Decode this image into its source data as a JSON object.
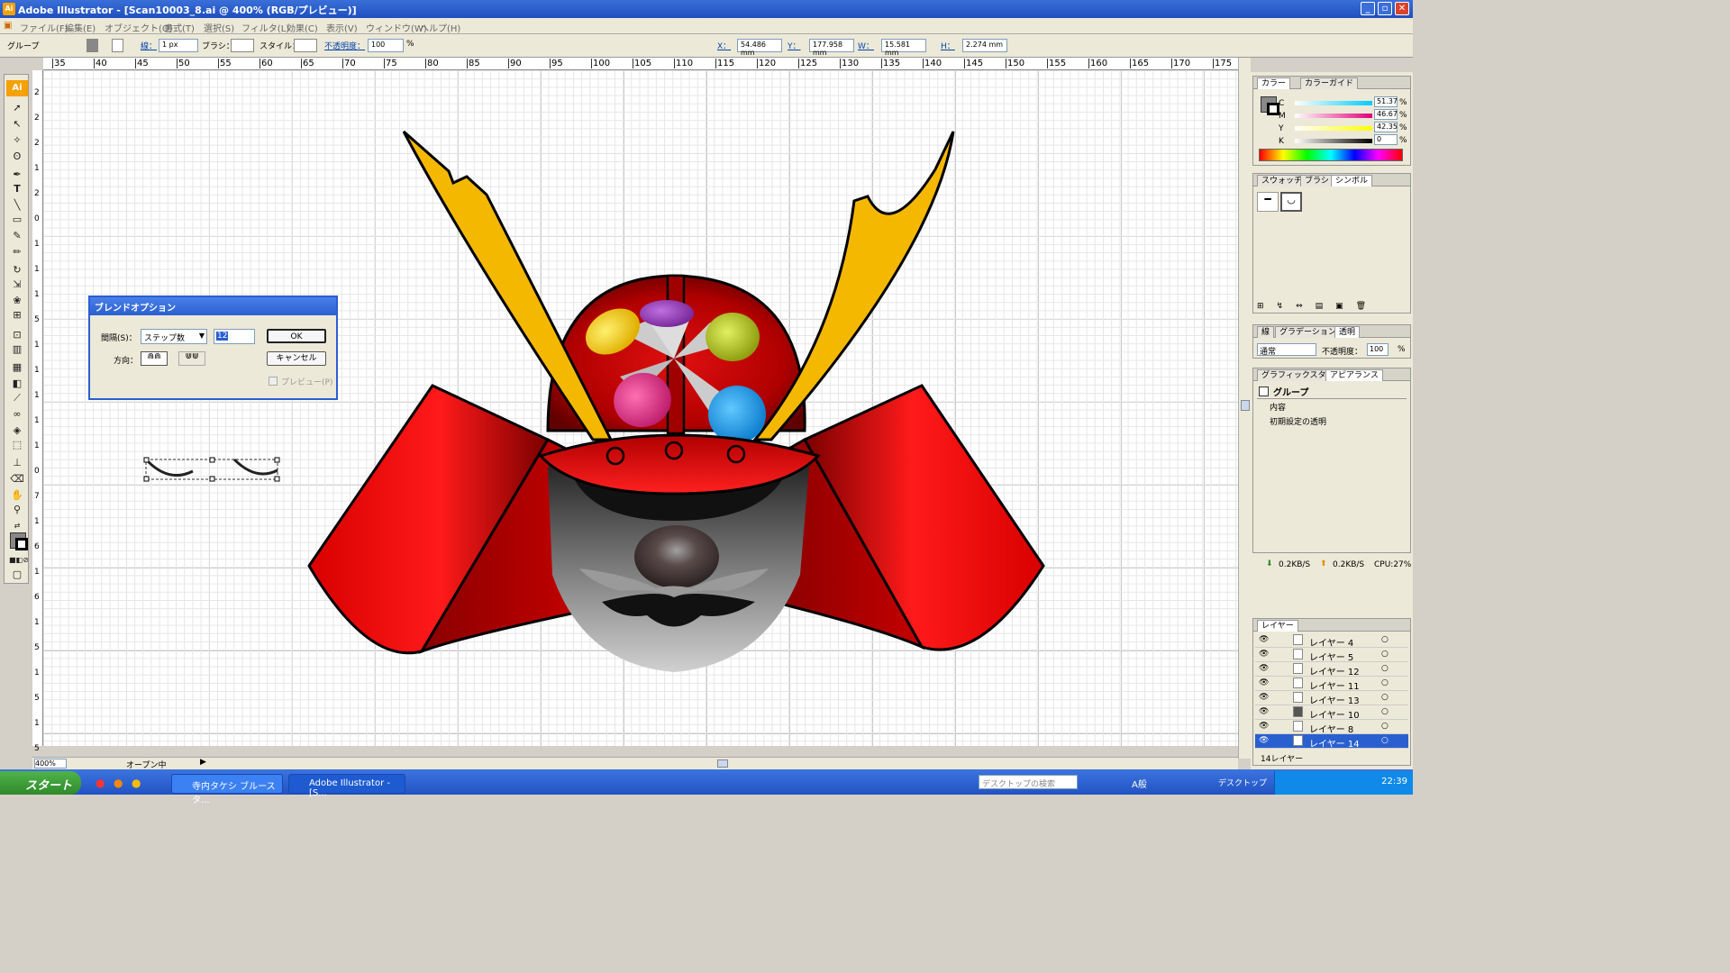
{
  "window": {
    "title": "Adobe Illustrator - [Scan10003_8.ai @ 400% (RGB/プレビュー)]",
    "app_icon": "Ai"
  },
  "menus": [
    "ファイル(F)",
    "編集(E)",
    "オブジェクト(O)",
    "書式(T)",
    "選択(S)",
    "フィルタ(L)",
    "効果(C)",
    "表示(V)",
    "ウィンドウ(W)",
    "ヘルプ(H)"
  ],
  "control": {
    "selection": "グループ",
    "stroke_label": "線：",
    "stroke_value": "1 px",
    "brush_label": "ブラシ：",
    "style_label": "スタイル：",
    "opacity_label": "不透明度：",
    "opacity_value": "100",
    "percent": "%",
    "x_label": "X：",
    "x_value": "54.486 mm",
    "y_label": "Y：",
    "y_value": "177.958 mm",
    "w_label": "W：",
    "w_value": "15.581 mm",
    "h_label": "H：",
    "h_value": "2.274 mm"
  },
  "ruler": {
    "top": [
      "35",
      "40",
      "45",
      "50",
      "55",
      "60",
      "65",
      "70",
      "75",
      "80",
      "85",
      "90",
      "95",
      "100",
      "105",
      "110",
      "115",
      "120",
      "125",
      "130",
      "135",
      "140",
      "145",
      "150",
      "155",
      "160",
      "165",
      "170",
      "175"
    ],
    "left": [
      "2",
      "2",
      "2",
      "1",
      "2",
      "0",
      "1",
      "1",
      "1",
      "5",
      "1",
      "1",
      "1",
      "1",
      "1",
      "0",
      "7",
      "1",
      "6",
      "1",
      "6",
      "1",
      "5",
      "1",
      "5",
      "1",
      "5"
    ]
  },
  "dialog": {
    "title": "ブレンドオプション",
    "spacing_label": "間隔(S)：",
    "spacing_select": "ステップ数",
    "spacing_value": "12",
    "direction_label": "方向：",
    "ok": "OK",
    "cancel": "キャンセル",
    "preview": "プレビュー(P)"
  },
  "color_panel": {
    "tabs": [
      "カラー",
      "カラーガイド"
    ],
    "channels": [
      {
        "label": "C",
        "value": "51.37"
      },
      {
        "label": "M",
        "value": "46.67"
      },
      {
        "label": "Y",
        "value": "42.35"
      },
      {
        "label": "K",
        "value": "0"
      }
    ],
    "percent": "%"
  },
  "swatch_panel": {
    "tabs": [
      "スウォッチ",
      "ブラシ",
      "シンボル"
    ]
  },
  "stroke_panel": {
    "tabs": [
      "線",
      "グラデーション",
      "透明"
    ],
    "mode": "通常",
    "opacity_label": "不透明度：",
    "opacity_value": "100",
    "percent": "%"
  },
  "appearance_panel": {
    "tabs": [
      "グラフィックスタイル",
      "アピアランス"
    ],
    "object": "グループ",
    "items": [
      "内容",
      "初期設定の透明"
    ]
  },
  "net": {
    "down": "0.2KB/S",
    "up": "0.2KB/S",
    "cpu": "CPU:27%"
  },
  "layers_panel": {
    "tab": "レイヤー",
    "layers": [
      "レイヤー 4",
      "レイヤー 5",
      "レイヤー 12",
      "レイヤー 11",
      "レイヤー 13",
      "レイヤー 10",
      "レイヤー 8",
      "レイヤー 14"
    ],
    "selected_index": 7,
    "count": "14レイヤー"
  },
  "status": {
    "zoom": "400%",
    "state": "オープン中"
  },
  "taskbar": {
    "start": "スタート",
    "tasks": [
      "寺内タケシ ブルースタ...",
      "Adobe Illustrator - [S..."
    ],
    "search_placeholder": "デスクトップの検索",
    "desktop": "デスクトップ",
    "ime": "A般",
    "time": "22:39"
  }
}
